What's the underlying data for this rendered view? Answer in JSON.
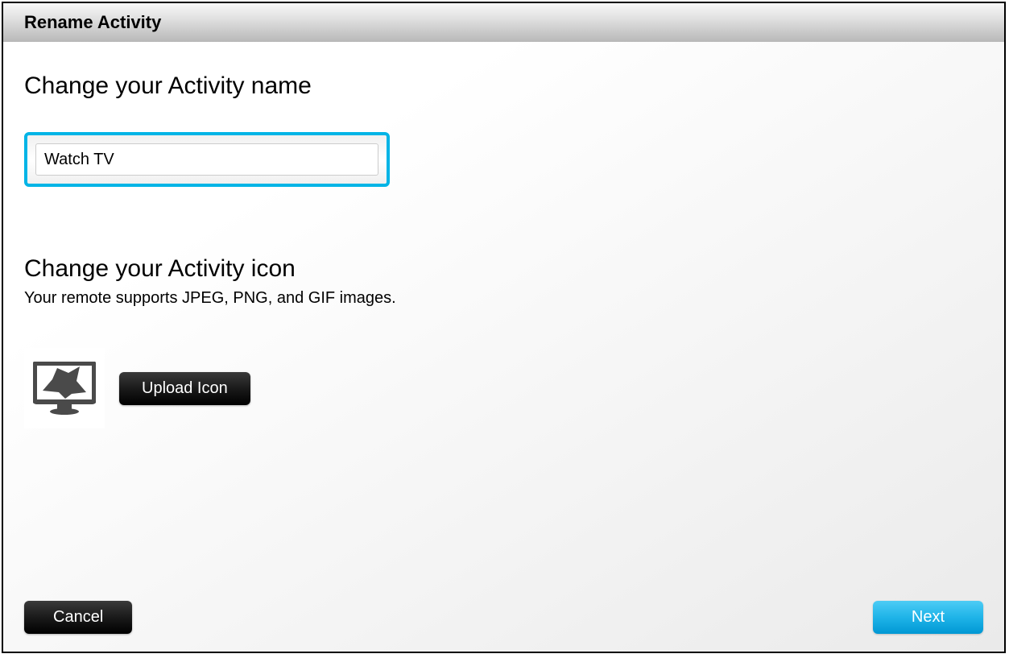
{
  "header": {
    "title": "Rename Activity"
  },
  "sections": {
    "name": {
      "heading": "Change your Activity name",
      "input_value": "Watch TV"
    },
    "icon": {
      "heading": "Change your Activity icon",
      "subtext": "Your remote supports JPEG, PNG, and GIF images.",
      "upload_button": "Upload Icon",
      "icon_name": "tv-star-icon"
    }
  },
  "footer": {
    "cancel_button": "Cancel",
    "next_button": "Next"
  },
  "colors": {
    "focus_border": "#00b4e6",
    "primary_button": "#1fb4e8",
    "dark_button": "#000000"
  }
}
